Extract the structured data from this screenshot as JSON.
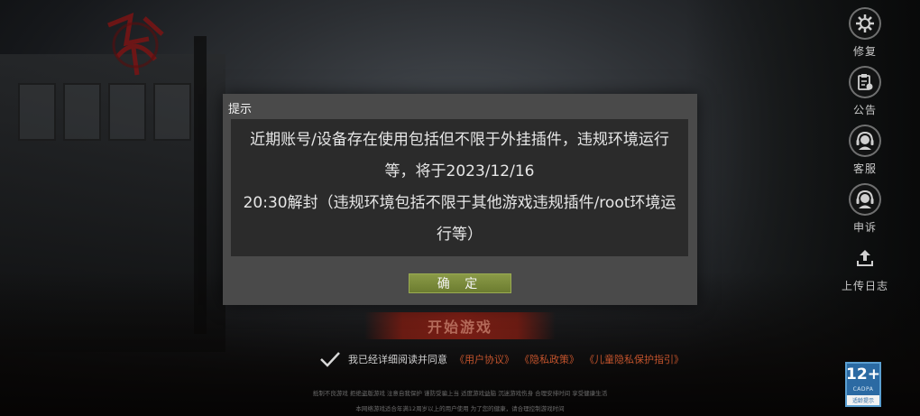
{
  "dialog": {
    "title": "提示",
    "message": "近期账号/设备存在使用包括但不限于外挂插件，违规环境运行等，将于2023/12/16\n20:30解封（违规环境包括不限于其他游戏违规插件/root环境运行等）",
    "confirm_label": "确 定"
  },
  "side_menu": {
    "items": [
      {
        "label": "修复",
        "icon": "repair-gear-icon"
      },
      {
        "label": "公告",
        "icon": "announcement-clipboard-icon"
      },
      {
        "label": "客服",
        "icon": "customer-service-headset-icon"
      },
      {
        "label": "申诉",
        "icon": "appeal-headset-icon"
      },
      {
        "label": "上传日志",
        "icon": "upload-icon"
      }
    ]
  },
  "start_button": {
    "label": "开始游戏"
  },
  "agreement": {
    "text": "我已经详细阅读并同意",
    "links": [
      "《用户协议》",
      "《隐私政策》",
      "《儿童隐私保护指引》"
    ]
  },
  "footer": {
    "notice_line1": "抵制不良游戏 拒绝盗版游戏 注意自我保护 谨防受骗上当 适度游戏益脑 沉迷游戏伤身 合理安排时间 享受健康生活",
    "notice_line2": "本网络游戏适合年满12周岁以上的用户使用  为了您的健康，请合理控制游戏时间"
  },
  "age_rating": {
    "number": "12+",
    "org": "CADPA",
    "caption": "适龄提示"
  },
  "colors": {
    "confirm_button": "#7a8a3b",
    "link_text": "#c2532c",
    "dialog_bg": "#4a4a4a",
    "dialog_body_bg": "#2b2b2b",
    "age_badge": "#2b6aa3"
  }
}
